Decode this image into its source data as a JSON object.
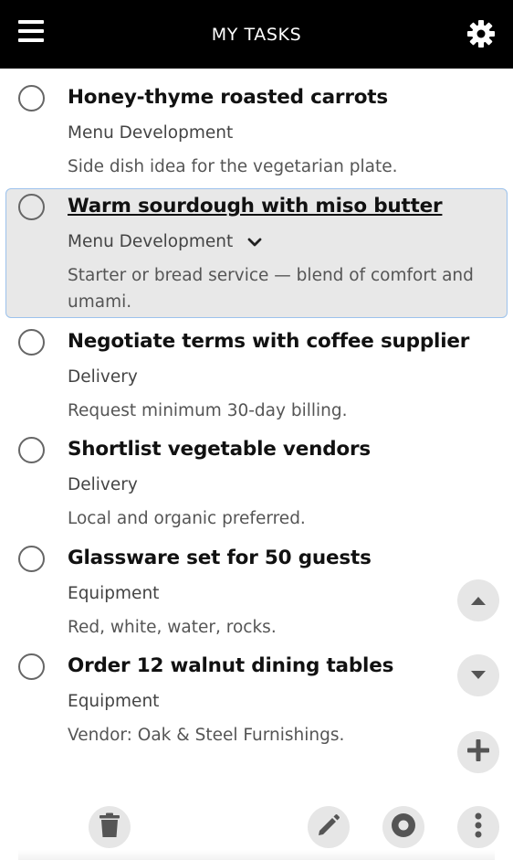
{
  "header": {
    "title": "MY TASKS",
    "menu_icon": "hamburger-menu-icon",
    "settings_icon": "gear-icon"
  },
  "tasks": [
    {
      "title": "Honey-thyme roasted carrots",
      "category": "Menu Development",
      "note": "Side dish idea for the vegetarian plate.",
      "selected": false
    },
    {
      "title": "Warm sourdough with miso butter",
      "category": "Menu Development",
      "note": "Starter or bread service — blend of comfort and umami.",
      "selected": true
    },
    {
      "title": "Negotiate terms with coffee supplier",
      "category": "Delivery",
      "note": "Request minimum 30-day billing.",
      "selected": false
    },
    {
      "title": "Shortlist vegetable vendors",
      "category": "Delivery",
      "note": "Local and organic preferred.",
      "selected": false
    },
    {
      "title": "Glassware set for 50 guests",
      "category": "Equipment",
      "note": "Red, white, water, rocks.",
      "selected": false
    },
    {
      "title": "Order 12 walnut dining tables",
      "category": "Equipment",
      "note": "Vendor: Oak & Steel Furnishings.",
      "selected": false
    }
  ],
  "side_actions": {
    "move_up_icon": "caret-up-icon",
    "move_down_icon": "caret-down-icon",
    "add_icon": "plus-icon"
  },
  "bottom_actions": {
    "delete_icon": "trash-icon",
    "edit_icon": "pencil-icon",
    "complete_icon": "record-icon",
    "more_icon": "more-vertical-icon"
  },
  "colors": {
    "header_bg": "#000000",
    "selected_bg": "#e8e8e8",
    "selected_border": "#9cc2ec",
    "button_bg": "#e6e6e6",
    "icon_color": "#555555"
  }
}
